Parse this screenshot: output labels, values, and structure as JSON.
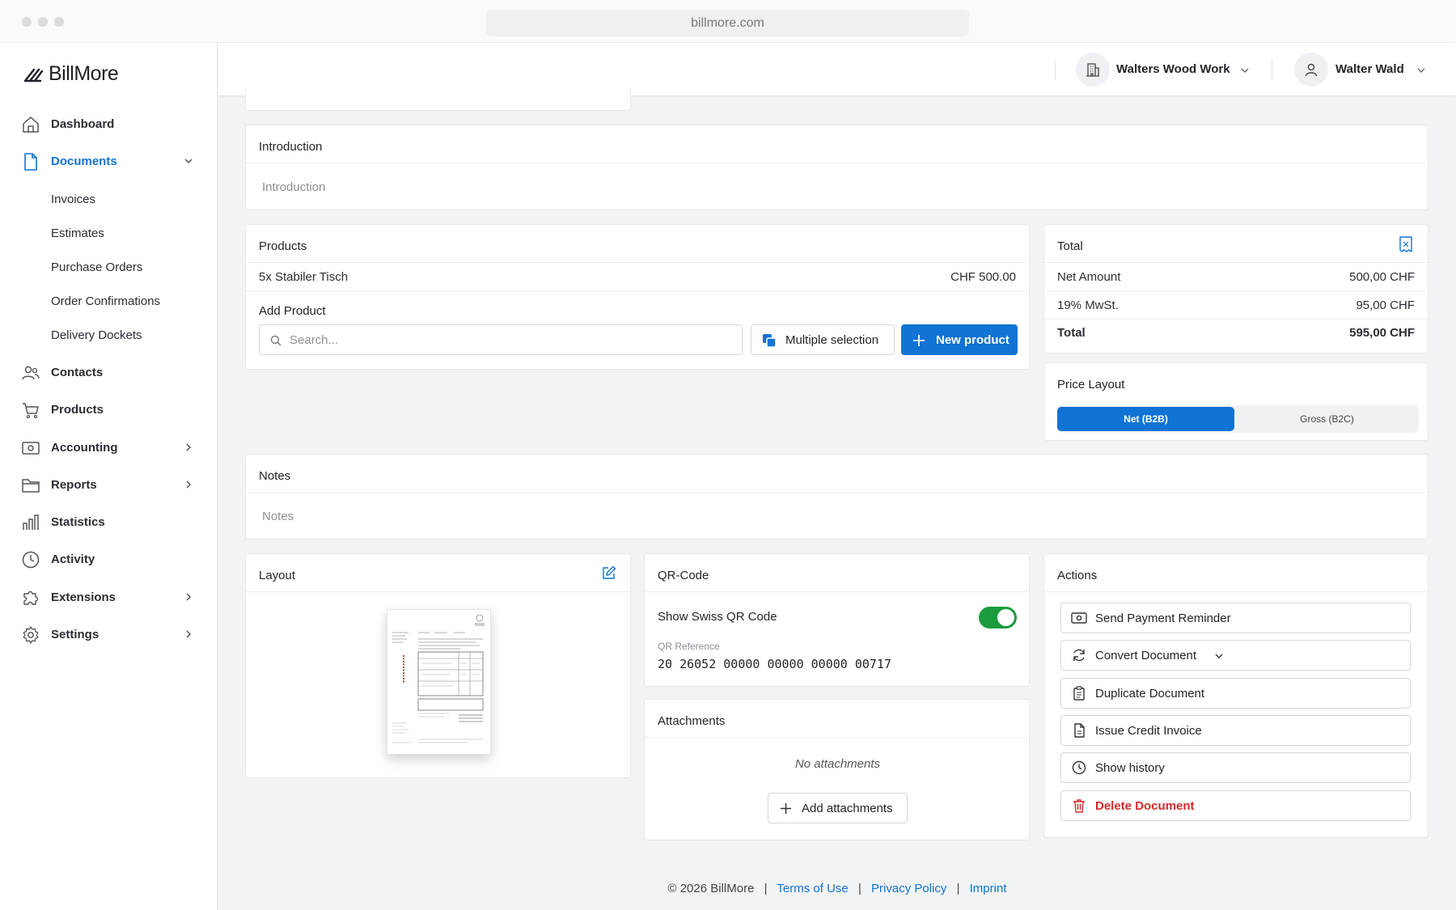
{
  "browser": {
    "url": "billmore.com"
  },
  "brand": {
    "name": "BillMore",
    "accent": "#1173d4",
    "danger": "#d42b2b",
    "success": "#1a9c3e"
  },
  "sidebar": {
    "dashboard": "Dashboard",
    "documents": "Documents",
    "documents_sub": {
      "invoices": "Invoices",
      "estimates": "Estimates",
      "purchase_orders": "Purchase Orders",
      "order_confirmations": "Order Confirmations",
      "delivery_dockets": "Delivery Dockets"
    },
    "contacts": "Contacts",
    "products": "Products",
    "accounting": "Accounting",
    "reports": "Reports",
    "statistics": "Statistics",
    "activity": "Activity",
    "extensions": "Extensions",
    "settings": "Settings"
  },
  "topbar": {
    "company": "Walters Wood Work",
    "user": "Walter Wald"
  },
  "introduction": {
    "title": "Introduction",
    "placeholder": "Introduction"
  },
  "products": {
    "title": "Products",
    "items": [
      {
        "name": "5x Stabiler Tisch",
        "price": "CHF 500.00"
      }
    ],
    "add_label": "Add Product",
    "search_placeholder": "Search...",
    "multiple_selection": "Multiple selection",
    "new_product": "New product"
  },
  "total": {
    "title": "Total",
    "net_label": "Net Amount",
    "net_value": "500,00 CHF",
    "vat_label": "19% MwSt.",
    "vat_value": "95,00 CHF",
    "total_label": "Total",
    "total_value": "595,00 CHF"
  },
  "price_layout": {
    "title": "Price Layout",
    "net": "Net (B2B)",
    "gross": "Gross (B2C)",
    "selected": "net"
  },
  "notes": {
    "title": "Notes",
    "placeholder": "Notes"
  },
  "layout": {
    "title": "Layout"
  },
  "qr": {
    "title": "QR-Code",
    "toggle_label": "Show Swiss QR Code",
    "toggle_on": true,
    "ref_label": "QR Reference",
    "ref_value": "20 26052 00000 00000 00000 00717"
  },
  "attachments": {
    "title": "Attachments",
    "empty": "No attachments",
    "add": "Add attachments"
  },
  "actions": {
    "title": "Actions",
    "send_reminder": "Send Payment Reminder",
    "convert": "Convert Document",
    "duplicate": "Duplicate Document",
    "credit": "Issue Credit Invoice",
    "history": "Show history",
    "delete": "Delete Document"
  },
  "footer": {
    "copyright": "© 2026 BillMore",
    "sep": "|",
    "terms": "Terms of Use",
    "privacy": "Privacy Policy",
    "imprint": "Imprint"
  }
}
